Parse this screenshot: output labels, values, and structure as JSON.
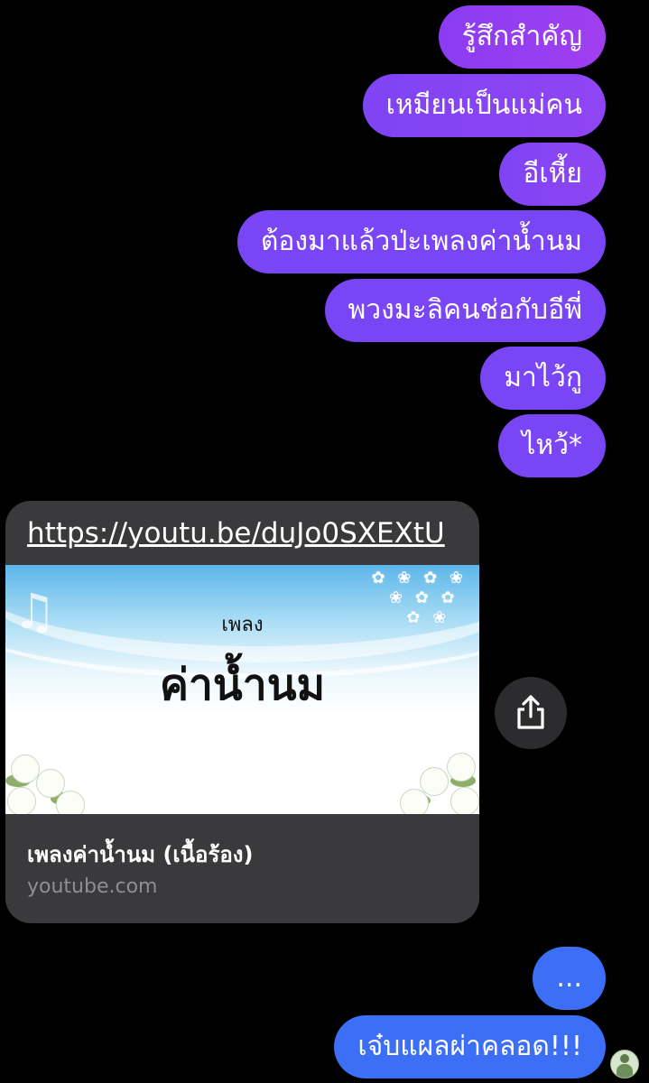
{
  "messages_sent": [
    {
      "text": "รู้สึกสำคัญ"
    },
    {
      "text": "เหมียนเป็นแม่คน"
    },
    {
      "text": "อีเหี้ย"
    },
    {
      "text": "ต้องมาแล้วป่ะเพลงค่าน้ำนม"
    },
    {
      "text": "พวงมะลิคนช่อกับอีพี่"
    },
    {
      "text": "มาไว้กู"
    },
    {
      "text": "ไหว้*"
    }
  ],
  "link_card": {
    "url": "https://youtu.be/duJo0SXEXtU",
    "thumbnail_small_text": "เพลง",
    "thumbnail_big_text": "ค่าน้ำนม",
    "title": "เพลงค่าน้ำนม (เนื้อร้อง)",
    "domain": "youtube.com"
  },
  "messages_later": [
    {
      "text": "..."
    },
    {
      "text": "เจ๋บแผลผ่าคลอด!!!"
    }
  ],
  "icons": {
    "share": "share-icon",
    "avatar": "avatar"
  },
  "colors": {
    "sent_bubble": "#7a45f5",
    "blue_bubble": "#3c6ef6",
    "card_background": "#3a3a3c",
    "background": "#000000"
  }
}
